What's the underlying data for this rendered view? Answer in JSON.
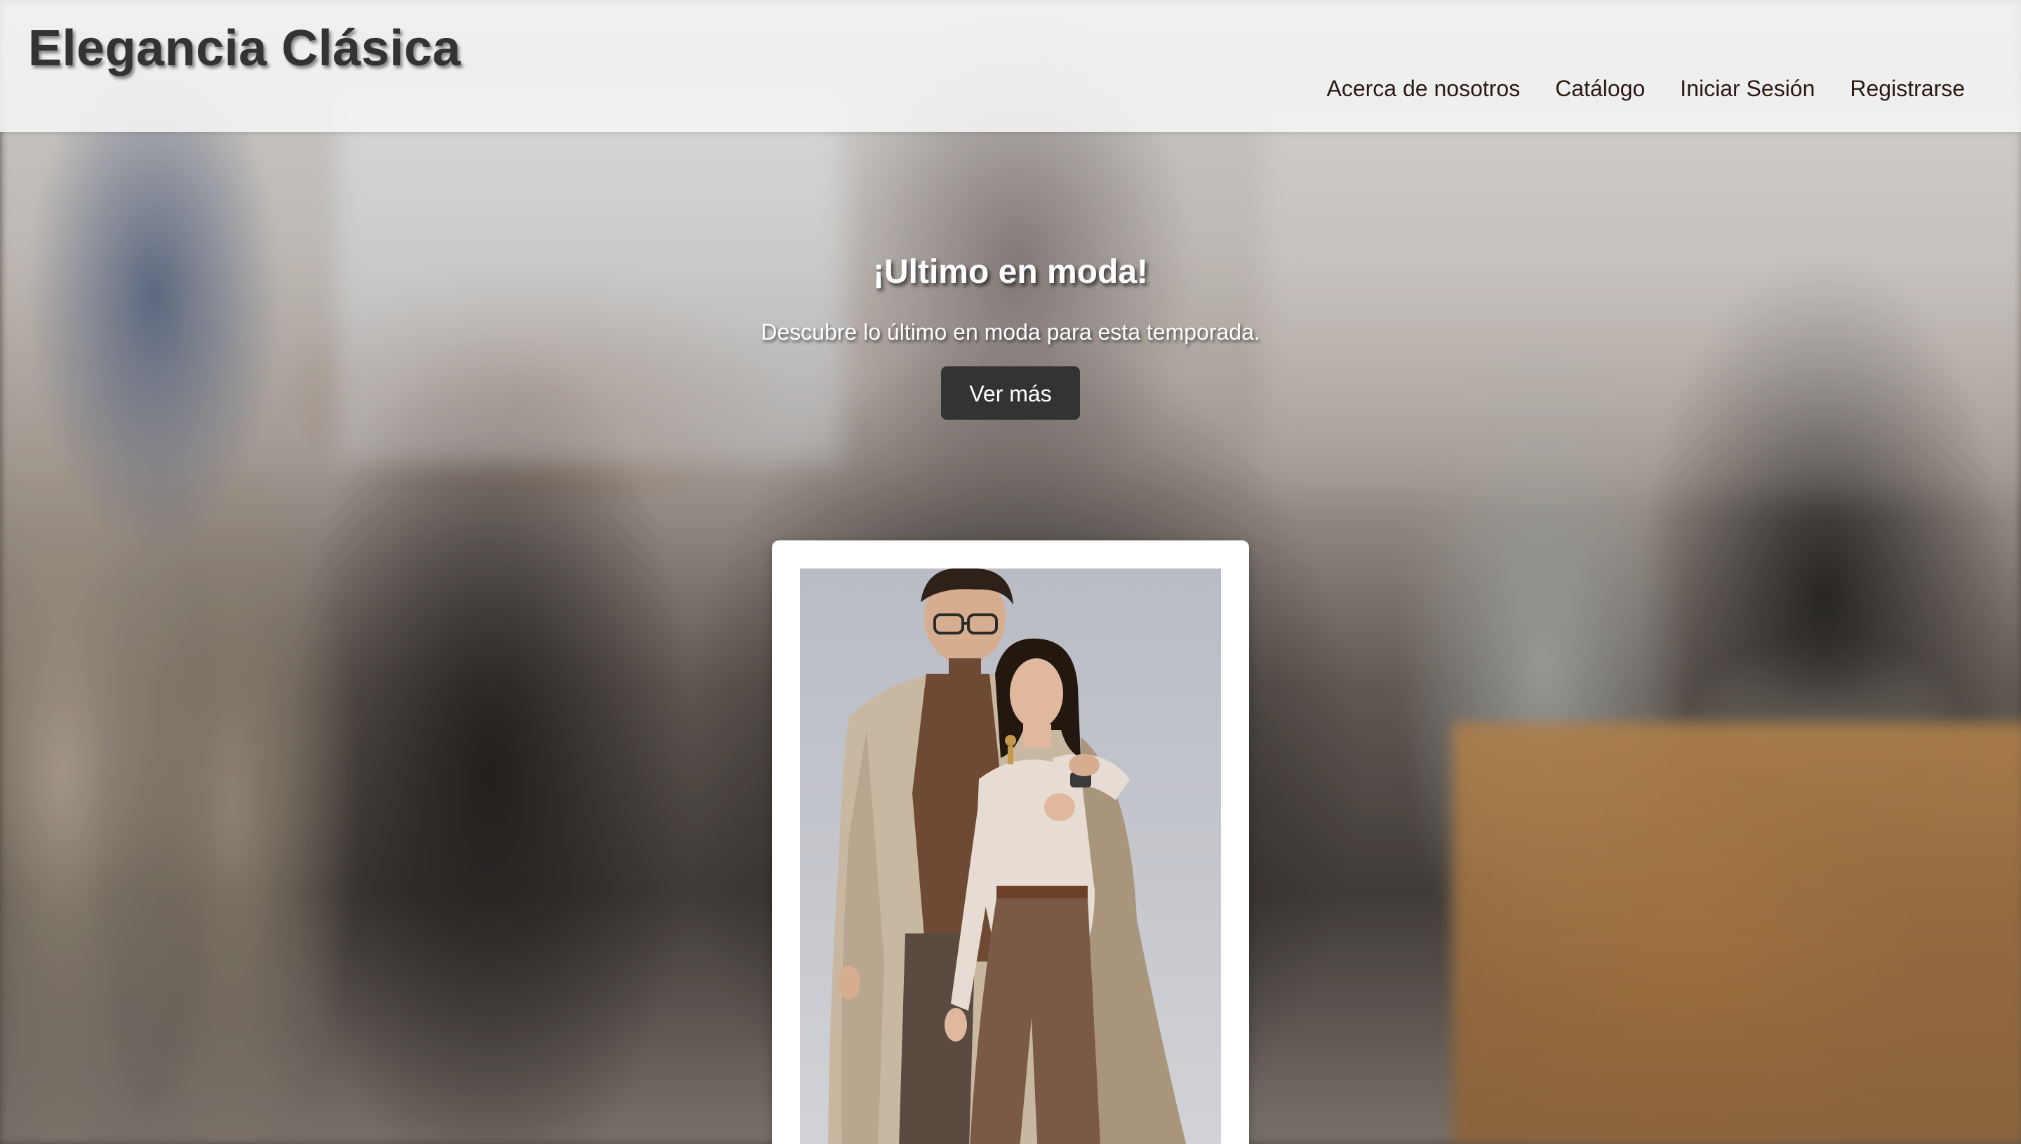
{
  "header": {
    "brand": "Elegancia Clásica",
    "nav": [
      {
        "label": "Acerca de nosotros"
      },
      {
        "label": "Catálogo"
      },
      {
        "label": "Iniciar Sesión"
      },
      {
        "label": "Registrarse"
      }
    ]
  },
  "hero": {
    "title": "¡Ultimo en moda!",
    "subtitle": "Descubre lo último en moda para esta temporada.",
    "cta_label": "Ver más"
  },
  "colors": {
    "header_bg": "#f5f5f5",
    "brand_text": "#333333",
    "nav_text": "#2a1a12",
    "button_bg": "#333333",
    "button_text": "#ffffff"
  }
}
